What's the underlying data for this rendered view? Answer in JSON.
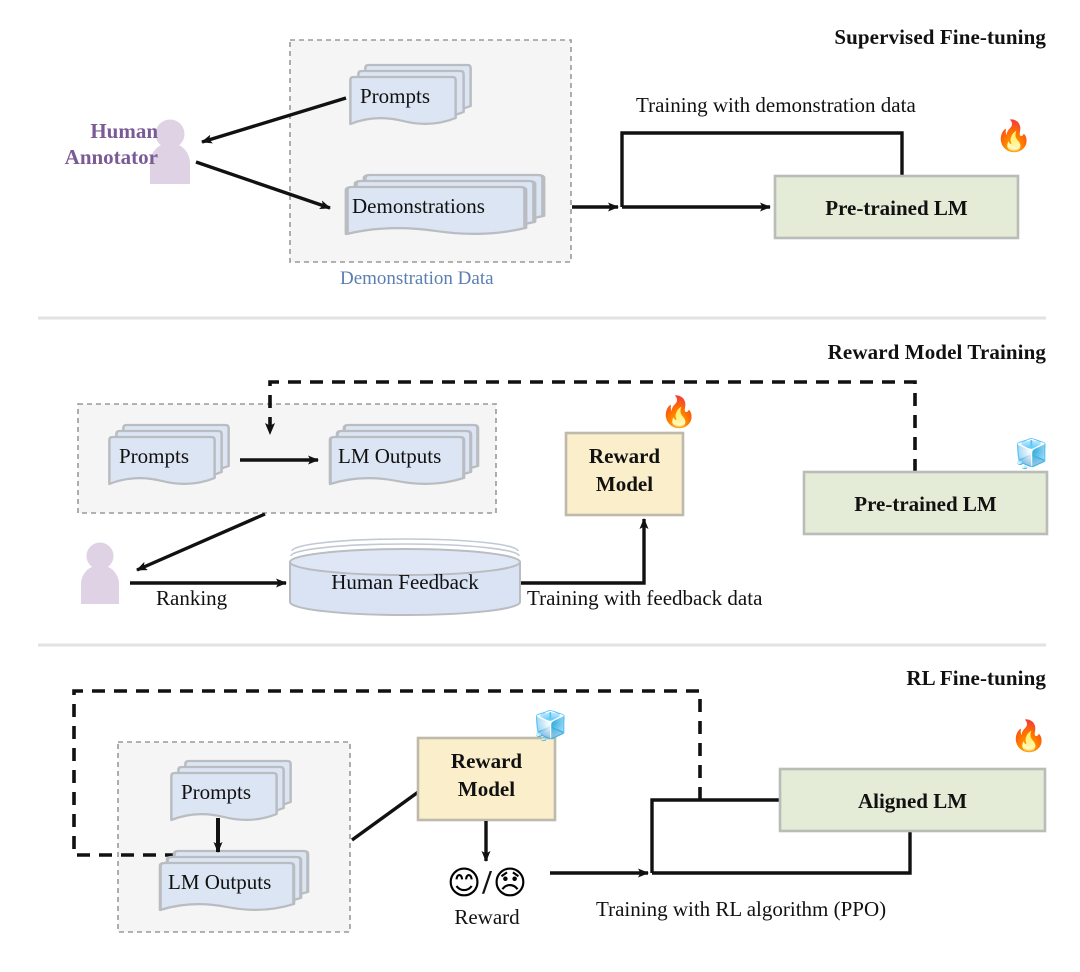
{
  "figure": {
    "kind": "rlhf-three-stage-pipeline-diagram",
    "colors": {
      "document_fill": "#dce5f3",
      "document_stroke": "#b9bcc0",
      "lm_box_fill": "#e4ebd7",
      "lm_box_stroke": "#b9bcb7",
      "reward_box_fill": "#faeecb",
      "reward_box_stroke": "#bdb9ab",
      "group_fill": "#f5f5f5",
      "group_stroke": "#9a9a9a",
      "annotator_purple": "#7b5b96",
      "person_icon_fill": "#ded2e4",
      "caption_blue": "#5b7fb0",
      "divider": "#e2e2e2",
      "arrow": "#111111",
      "cylinder_fill": "#d9e3f4"
    }
  },
  "panels": [
    {
      "id": "supervised-fine-tuning",
      "title": "Supervised Fine-tuning",
      "actor": {
        "line1": "Human",
        "line2": "Annotator",
        "icon": "person-icon"
      },
      "group_caption": "Demonstration Data",
      "documents": [
        {
          "label": "Prompts"
        },
        {
          "label": "Demonstrations"
        }
      ],
      "edge_note": "Training with demonstration data",
      "model": {
        "label": "Pre-trained LM",
        "state_icon": "fire-emoji",
        "state": "trainable"
      }
    },
    {
      "id": "reward-model-training",
      "title": "Reward Model Training",
      "actor": {
        "icon": "person-icon"
      },
      "documents": [
        {
          "label": "Prompts"
        },
        {
          "label": "LM Outputs"
        }
      ],
      "ranking_label": "Ranking",
      "store": {
        "label": "Human Feedback",
        "shape": "cylinder"
      },
      "edge_note": "Training with feedback data",
      "reward_model": {
        "line1": "Reward",
        "line2": "Model",
        "state_icon": "fire-emoji",
        "state": "trainable"
      },
      "model": {
        "label": "Pre-trained LM",
        "state_icon": "ice-emoji",
        "state": "frozen"
      }
    },
    {
      "id": "rl-fine-tuning",
      "title": "RL Fine-tuning",
      "documents": [
        {
          "label": "Prompts"
        },
        {
          "label": "LM Outputs"
        }
      ],
      "reward_model": {
        "line1": "Reward",
        "line2": "Model",
        "state_icon": "ice-emoji",
        "state": "frozen"
      },
      "reward_signal": {
        "positive_icon": "smiling-face-emoji",
        "separator": "/",
        "negative_icon": "disappointed-face-emoji",
        "label": "Reward"
      },
      "edge_note": "Training with RL algorithm (PPO)",
      "model": {
        "label": "Aligned LM",
        "state_icon": "fire-emoji",
        "state": "trainable"
      }
    }
  ],
  "icons": {
    "fire": "🔥",
    "ice": "🧊",
    "smile": "😊",
    "frown": "😞"
  }
}
